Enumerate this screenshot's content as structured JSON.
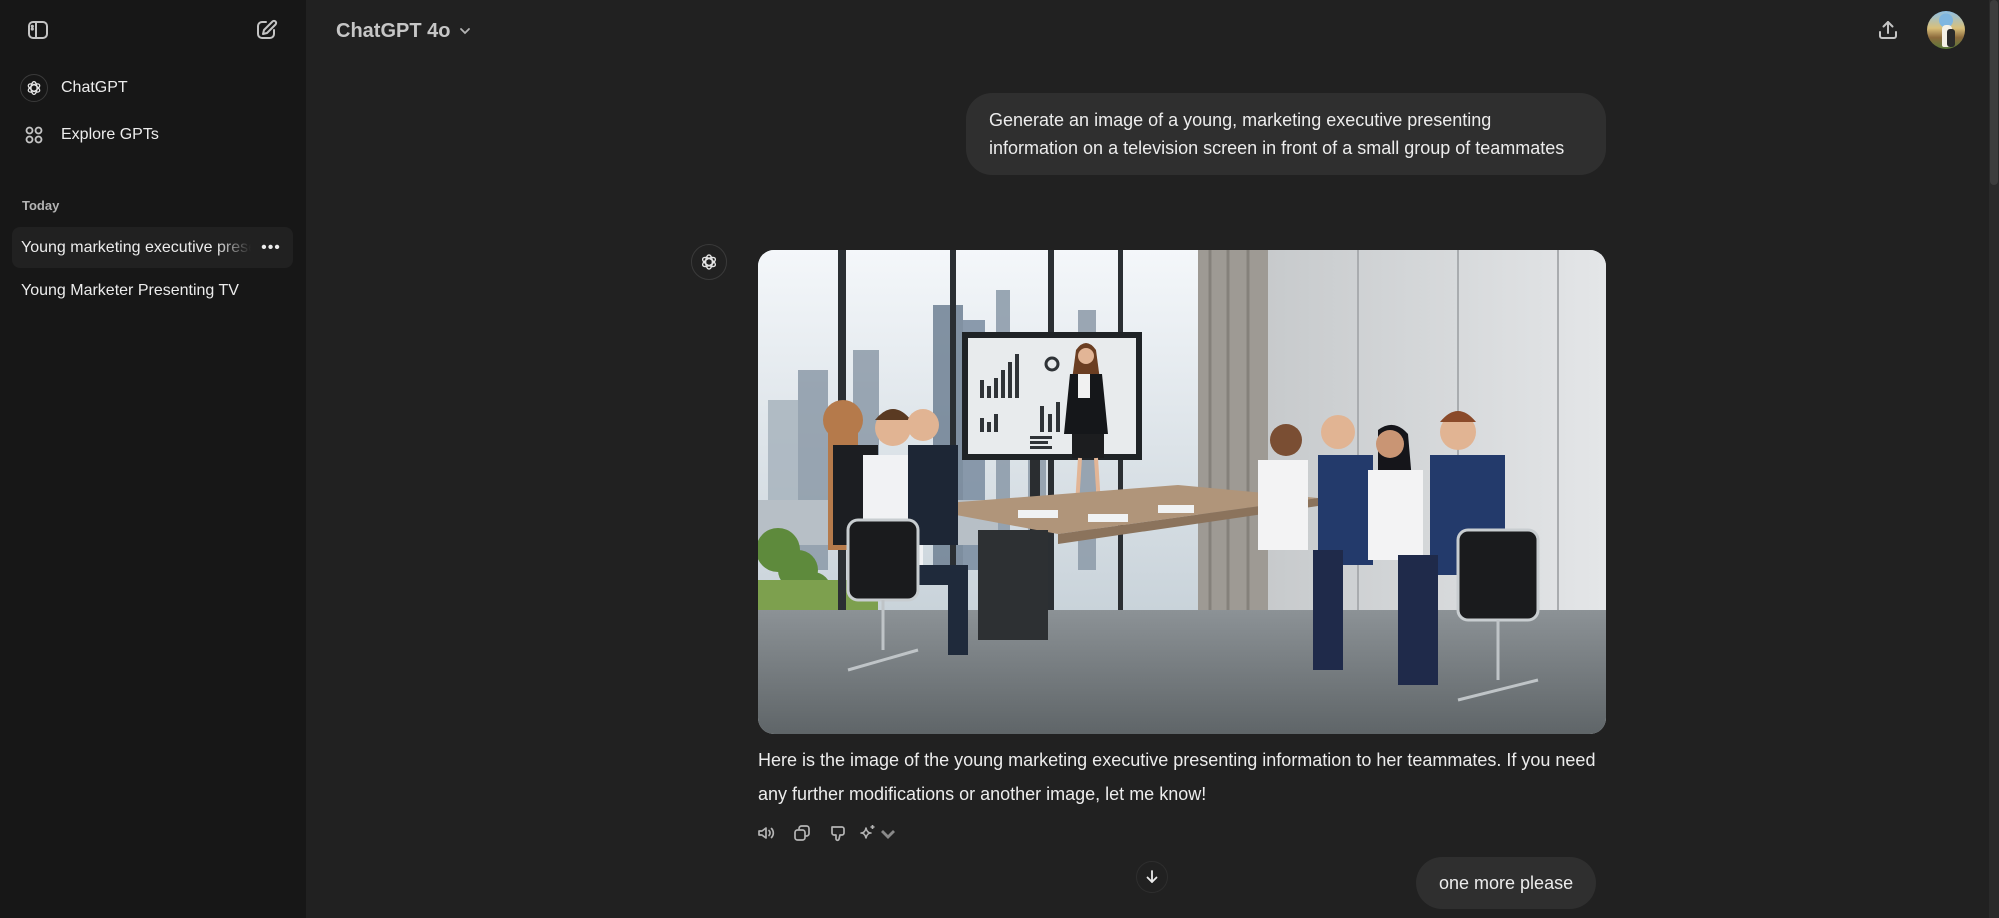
{
  "sidebar": {
    "toggle_icon": "sidebar-toggle-icon",
    "new_chat_icon": "new-chat-pencil-icon",
    "nav": [
      {
        "label": "ChatGPT",
        "icon": "openai-logo-icon"
      },
      {
        "label": "Explore GPTs",
        "icon": "grid-four-circles-icon"
      }
    ],
    "section_label": "Today",
    "chats": [
      {
        "label": "Young marketing executive presenting",
        "active": true,
        "options_icon": "more-dots-icon"
      },
      {
        "label": "Young Marketer Presenting TV",
        "active": false
      }
    ]
  },
  "header": {
    "model_label": "ChatGPT 4o",
    "model_chevron_icon": "chevron-down-icon",
    "share_icon": "share-upload-icon",
    "avatar": "user-avatar"
  },
  "conversation": {
    "messages": [
      {
        "role": "user",
        "text": "Generate an image of a young, marketing executive presenting information on a television screen in front of a small group of teammates"
      },
      {
        "role": "assistant",
        "image": "generated image: young marketing executive presenting charts on a TV screen to seven seated teammates in a glass-walled office",
        "text": "Here is the image of the young marketing executive presenting information to her teammates. If you need any further modifications or another image, let me know!"
      },
      {
        "role": "user",
        "text": "one more please"
      }
    ],
    "assistant_actions": [
      {
        "name": "read-aloud",
        "icon": "speaker-icon"
      },
      {
        "name": "copy",
        "icon": "copy-icon"
      },
      {
        "name": "bad-response",
        "icon": "thumbs-down-icon"
      },
      {
        "name": "regenerate",
        "icon": "sparkle-icon"
      }
    ],
    "scroll_down_icon": "arrow-down-icon"
  },
  "colors": {
    "sidebar_bg": "#171717",
    "main_bg": "#212121",
    "bubble_bg": "#2f2f2f",
    "text": "#ececec"
  }
}
